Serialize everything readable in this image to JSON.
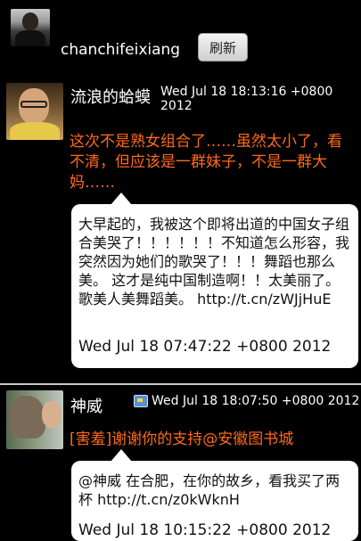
{
  "header": {
    "username": "chanchifeixiang",
    "refresh_label": "刷新"
  },
  "posts": [
    {
      "author": "流浪的蛤蟆",
      "time": "Wed Jul 18 18:13:16 +0800 2012",
      "text": "这次不是熟女组合了……虽然太小了，看不清，但应该是一群妹子，不是一群大妈……",
      "retweet": {
        "text": "大早起的，我被这个即将出道的中国女子组合美哭了！！！！！！不知道怎么形容，我突然因为她们的歌哭了！！！舞蹈也那么美。 这才是纯中国制造啊！！太美丽了。 歌美人美舞蹈美。 http://t.cn/zWJjHuE",
        "time": "Wed Jul 18 07:47:22 +0800 2012"
      }
    },
    {
      "author": "神威",
      "time": "Wed Jul 18 18:07:50 +0800 2012",
      "has_image_icon": true,
      "text": "[害羞]谢谢你的支持@安徽图书城",
      "retweet": {
        "text": "@神威 在合肥，在你的故乡，看我买了两杯 http://t.cn/z0kWknH",
        "time": "Wed Jul 18 10:15:22 +0800 2012"
      }
    }
  ],
  "colors": {
    "background": "#000000",
    "accent_text": "#ff6a1a",
    "bubble": "#ffffff"
  }
}
